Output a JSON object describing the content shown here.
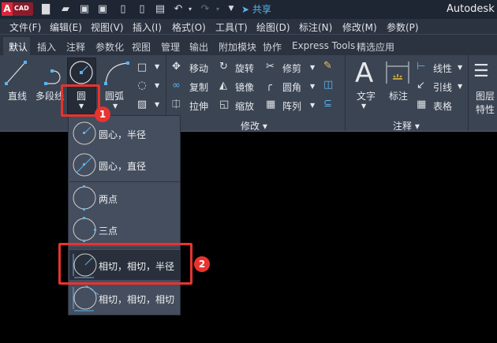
{
  "titlebar": {
    "logo": "A CAD",
    "share": "共享",
    "app_title": "Autodesk A"
  },
  "menubar": [
    "文件(F)",
    "编辑(E)",
    "视图(V)",
    "插入(I)",
    "格式(O)",
    "工具(T)",
    "绘图(D)",
    "标注(N)",
    "修改(M)",
    "参数(P)"
  ],
  "tabs": [
    "默认",
    "插入",
    "注释",
    "参数化",
    "视图",
    "管理",
    "输出",
    "附加模块",
    "协作",
    "Express Tools",
    "精选应用"
  ],
  "draw": {
    "line": "直线",
    "polyline": "多段线",
    "circle": "圆",
    "arc": "圆弧"
  },
  "modify": {
    "move": "移动",
    "rotate": "旋转",
    "trim": "修剪",
    "copy": "复制",
    "mirror": "镜像",
    "fillet": "圆角",
    "stretch": "拉伸",
    "scale": "缩放",
    "array": "阵列",
    "panel": "修改"
  },
  "annotation": {
    "text": "文字",
    "dimension": "标注",
    "linear": "线性",
    "leader": "引线",
    "table": "表格",
    "panel": "注释"
  },
  "layers": {
    "label1": "图层",
    "label2": "特性"
  },
  "circle_menu": [
    "圆心，半径",
    "圆心，直径",
    "两点",
    "三点",
    "相切，相切，半径",
    "相切，相切，相切"
  ],
  "badges": [
    "1",
    "2"
  ]
}
